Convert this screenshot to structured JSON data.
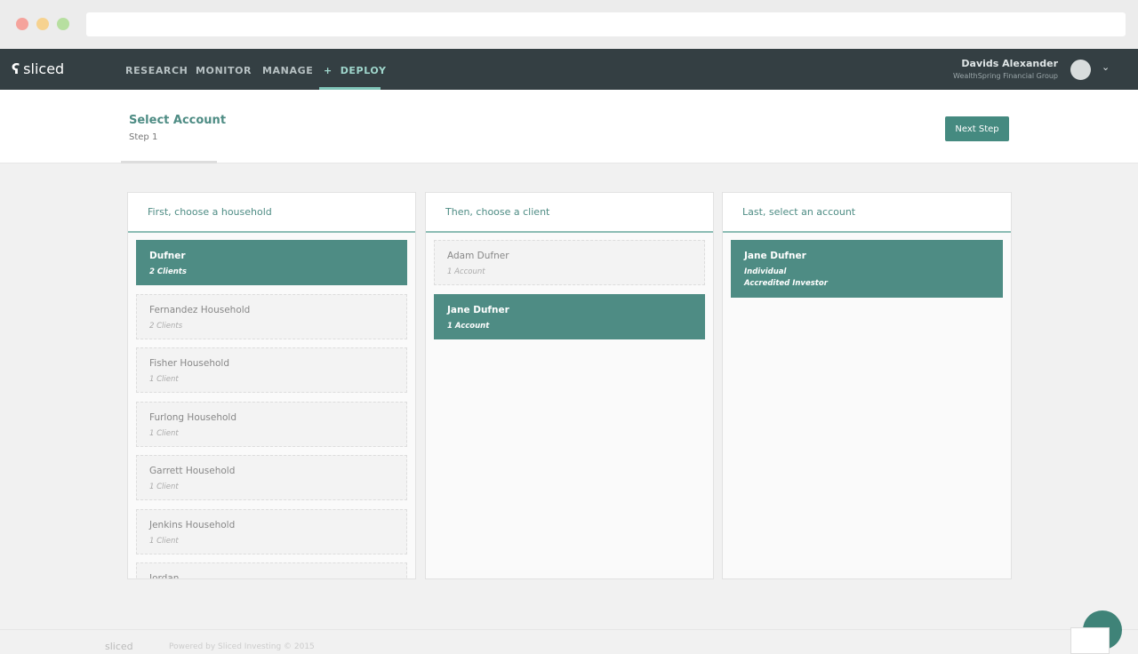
{
  "nav": {
    "logo": "sliced",
    "items": [
      "RESEARCH",
      "MONITOR",
      "MANAGE",
      "DEPLOY"
    ],
    "active": "DEPLOY",
    "deploy_icon": "plus-icon"
  },
  "user": {
    "name": "Davids Alexander",
    "org": "WealthSpring Financial Group"
  },
  "header": {
    "title": "Select Account",
    "step": "Step 1",
    "next_label": "Next Step"
  },
  "colors": {
    "accent": "#4e8c84",
    "nav": "#343f43"
  },
  "columns": [
    {
      "title": "First, choose a household",
      "items": [
        {
          "name": "Dufner",
          "sub": [
            "2 Clients"
          ],
          "selected": true
        },
        {
          "name": "Fernandez Household",
          "sub": [
            "2 Clients"
          ]
        },
        {
          "name": "Fisher Household",
          "sub": [
            "1 Client"
          ]
        },
        {
          "name": "Furlong Household",
          "sub": [
            "1 Client"
          ]
        },
        {
          "name": "Garrett Household",
          "sub": [
            "1 Client"
          ]
        },
        {
          "name": "Jenkins Household",
          "sub": [
            "1 Client"
          ]
        },
        {
          "name": "Jordan",
          "sub": []
        }
      ]
    },
    {
      "title": "Then, choose a client",
      "items": [
        {
          "name": "Adam Dufner",
          "sub": [
            "1 Account"
          ]
        },
        {
          "name": "Jane Dufner",
          "sub": [
            "1 Account"
          ],
          "selected": true
        }
      ]
    },
    {
      "title": "Last, select an account",
      "items": [
        {
          "name": "Jane Dufner",
          "sub": [
            "Individual",
            "Accredited Investor"
          ],
          "selected": true
        }
      ]
    }
  ],
  "footer": {
    "logo": "sliced",
    "text": "Powered by Sliced Investing © 2015"
  }
}
